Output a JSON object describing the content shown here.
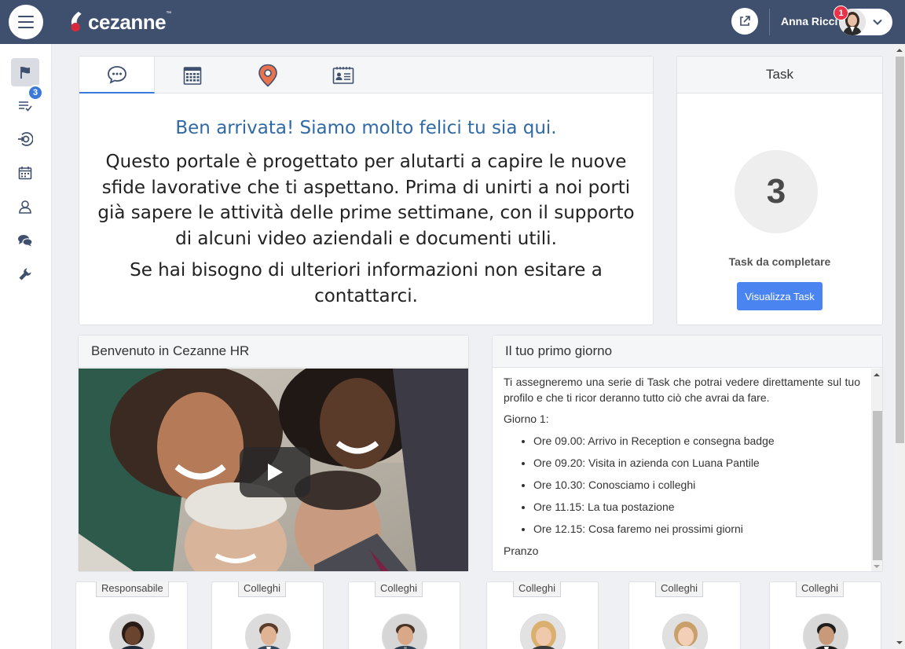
{
  "topbar": {
    "logo_text": "cezanne",
    "logo_tm": "™",
    "user_name": "Anna Ricci",
    "notification_count": "1"
  },
  "sidebar": {
    "tasks_badge": "3",
    "items": [
      "flag-icon",
      "task-list-icon",
      "onboarding-icon",
      "calendar-icon",
      "person-icon",
      "chat-icon",
      "wrench-icon"
    ]
  },
  "welcome": {
    "title": "Ben arrivata! Siamo molto felici tu sia qui.",
    "body": "Questo portale è progettato per alutarti a capire le nuove sfide lavorative che ti aspettano. Prima di unirti a noi porti già sapere le attività delle prime settimane, con il supporto di alcuni video aziendali e documenti utili.",
    "body2": "Se hai bisogno di ulteriori informazioni non esitare a contattarci.",
    "tabs": [
      "chat-icon",
      "calendar-icon",
      "location-pin-icon",
      "contact-card-icon"
    ]
  },
  "task": {
    "header": "Task",
    "count": "3",
    "label": "Task da completare",
    "button": "Visualizza Task"
  },
  "video": {
    "header": "Benvenuto in Cezanne HR"
  },
  "first_day": {
    "header": "Il tuo primo giorno",
    "intro": "Ti assegneremo una serie di Task che potrai vedere direttamente sul tuo profilo e che ti ricor deranno tutto ciò che avrai da fare.",
    "day_label": "Giorno 1:",
    "items": [
      "Ore 09.00: Arrivo in Reception e consegna badge",
      "Ore 09.20: Visita in azienda con Luana Pantile",
      "Ore 10.30: Conosciamo i colleghi",
      "Ore 11.15: La tua postazione",
      "Ore 12.15: Cosa faremo nei prossimi giorni"
    ],
    "after": "Pranzo"
  },
  "people": [
    {
      "role": "Responsabile"
    },
    {
      "role": "Colleghi"
    },
    {
      "role": "Colleghi"
    },
    {
      "role": "Colleghi"
    },
    {
      "role": "Colleghi"
    },
    {
      "role": "Colleghi"
    }
  ],
  "colors": {
    "topbar": "#3f4f6e",
    "accent": "#3b7ad9",
    "title_blue": "#2f6aa5",
    "button_blue": "#4a84f0",
    "badge_red": "#e8334a"
  }
}
